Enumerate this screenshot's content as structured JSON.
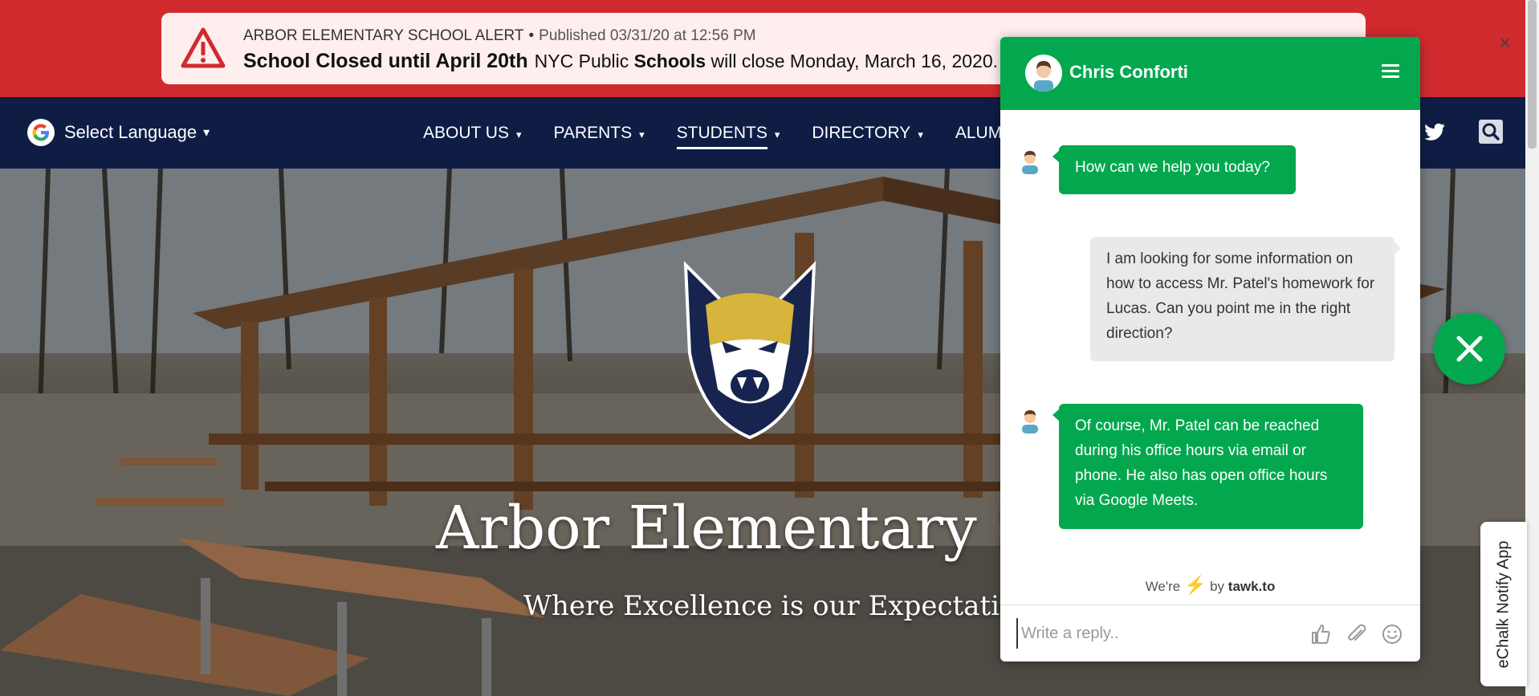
{
  "alert": {
    "category": "ARBOR ELEMENTARY SCHOOL ALERT",
    "separator": "•",
    "published": "Published 03/31/20 at 12:56 PM",
    "headline": "School Closed until April 20th",
    "body_pre": "NYC Public ",
    "body_bold": "Schools",
    "body_post": " will close Monday, March 16, 2020.",
    "close_label": "×"
  },
  "nav": {
    "language_label": "Select Language",
    "caret": "▾",
    "items": [
      {
        "label": "ABOUT US",
        "active": false
      },
      {
        "label": "PARENTS",
        "active": false
      },
      {
        "label": "STUDENTS",
        "active": true
      },
      {
        "label": "DIRECTORY",
        "active": false
      },
      {
        "label": "ALUMN",
        "active": false
      }
    ]
  },
  "hero": {
    "school_name": "Arbor Elementary Sch",
    "tagline": "Where Excellence is our Expectation!"
  },
  "chat": {
    "agent_name": "Chris Conforti",
    "messages": [
      {
        "from": "agent",
        "text": "How can we help you today?"
      },
      {
        "from": "visitor",
        "text": "I am looking for some information on how to access Mr. Patel's homework for Lucas. Can you point me in the right direction?"
      },
      {
        "from": "agent",
        "text": "Of course, Mr. Patel can be reached during his office hours via email or phone. He also has open office hours via Google Meets."
      }
    ],
    "powered_pre": "We're",
    "powered_by": "by",
    "powered_brand": "tawk.to",
    "reply_placeholder": "Write a reply.."
  },
  "echalk": {
    "label": "eChalk Notify App"
  },
  "colors": {
    "alert_red": "#d12a2e",
    "nav_navy": "#0f1d45",
    "chat_green": "#03a84e"
  }
}
